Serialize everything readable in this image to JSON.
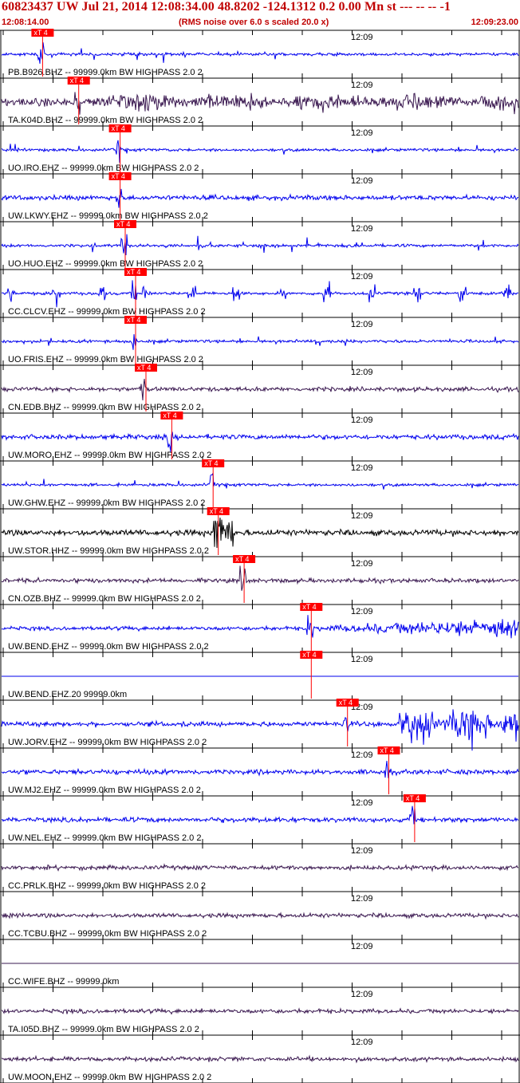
{
  "header": {
    "title": "60823437 UW Jul 21, 2014 12:08:34.00    48.8202 -124.1312  0.2 0.00 Mn st --- -- --   -1",
    "start_time": "12:08:14.00",
    "noise_note": "(RMS noise over 6.0 s scaled 20.0 x)",
    "end_time": "12:09:23.00"
  },
  "time_label": "12:09",
  "pick_label": "xT 4",
  "colors": {
    "header": "#c00000",
    "blue": "#0000ee",
    "dark": "#3a1850",
    "black": "#000000",
    "pick": "#ff0000"
  },
  "traces": [
    {
      "label": "PB.B926.BHZ -- 99999.0km BW  HIGHPASS  2.0  2",
      "color": "blue",
      "pick": 0.07,
      "style": "spiky"
    },
    {
      "label": "TA.K04D.BHZ -- 99999.0km BW  HIGHPASS  2.0  2",
      "color": "dark",
      "pick": 0.14,
      "style": "dense"
    },
    {
      "label": "UO.IRO.EHZ -- 99999.0km BW  HIGHPASS  2.0  2",
      "color": "blue",
      "pick": 0.22,
      "style": "spiky"
    },
    {
      "label": "UW.LKWY.EHZ -- 99999.0km BW  HIGHPASS  2.0  2",
      "color": "blue",
      "pick": 0.22,
      "style": "noisy"
    },
    {
      "label": "UO.HUO.EHZ -- 99999.0km BW  HIGHPASS  2.0  2",
      "color": "blue",
      "pick": 0.23,
      "style": "spiky"
    },
    {
      "label": "CC.CLCV.EHZ -- 99999.0km BW  HIGHPASS  2.0  2",
      "color": "blue",
      "pick": 0.25,
      "style": "bursts"
    },
    {
      "label": "UO.FRIS.EHZ -- 99999.0km BW  HIGHPASS  2.0  2",
      "color": "blue",
      "pick": 0.25,
      "style": "spiky"
    },
    {
      "label": "CN.EDB.BHZ -- 99999.0km BW  HIGHPASS  2.0  2",
      "color": "dark",
      "pick": 0.27,
      "style": "quiet"
    },
    {
      "label": "UW.MORO.EHZ -- 99999.0km BW  HIGHPASS  2.0  2",
      "color": "blue",
      "pick": 0.32,
      "style": "noisy"
    },
    {
      "label": "UW.GHW.EHZ -- 99999.0km BW  HIGHPASS  2.0  2",
      "color": "blue",
      "pick": 0.4,
      "style": "spiky"
    },
    {
      "label": "UW.STOR.HHZ -- 99999.0km BW  HIGHPASS  2.0  2",
      "color": "black",
      "pick": 0.41,
      "style": "event"
    },
    {
      "label": "CN.OZB.BHZ -- 99999.0km BW  HIGHPASS  2.0  2",
      "color": "dark",
      "pick": 0.46,
      "style": "quiet"
    },
    {
      "label": "UW.BEND.EHZ -- 99999.0km BW  HIGHPASS  2.0  2",
      "color": "blue",
      "pick": 0.59,
      "style": "growing"
    },
    {
      "label": "UW.BEND.EHZ.20 99999.0km",
      "color": "blue",
      "pick": 0.59,
      "style": "flat"
    },
    {
      "label": "UW.JORV.EHZ -- 99999.0km BW  HIGHPASS  2.0  2",
      "color": "blue",
      "pick": 0.66,
      "style": "bigevent"
    },
    {
      "label": "UW.MJ2.EHZ -- 99999.0km BW  HIGHPASS  2.0  2",
      "color": "blue",
      "pick": 0.74,
      "style": "noisy"
    },
    {
      "label": "UW.NEL.EHZ -- 99999.0km BW  HIGHPASS  2.0  2",
      "color": "blue",
      "pick": 0.79,
      "style": "noisy"
    },
    {
      "label": "CC.PRLK.BHZ -- 99999.0km BW  HIGHPASS  2.0  2",
      "color": "dark",
      "pick": null,
      "style": "quiet"
    },
    {
      "label": "CC.TCBU.BHZ -- 99999.0km BW  HIGHPASS  2.0  2",
      "color": "dark",
      "pick": null,
      "style": "quiet"
    },
    {
      "label": "CC.WIFE.BHZ -- 99999.0km",
      "color": "dark",
      "pick": null,
      "style": "flat"
    },
    {
      "label": "TA.I05D.BHZ -- 99999.0km BW  HIGHPASS  2.0  2",
      "color": "dark",
      "pick": null,
      "style": "quiet"
    },
    {
      "label": "UW.MOON.EHZ -- 99999.0km BW  HIGHPASS  2.0  2",
      "color": "dark",
      "pick": null,
      "style": "quiet"
    }
  ]
}
